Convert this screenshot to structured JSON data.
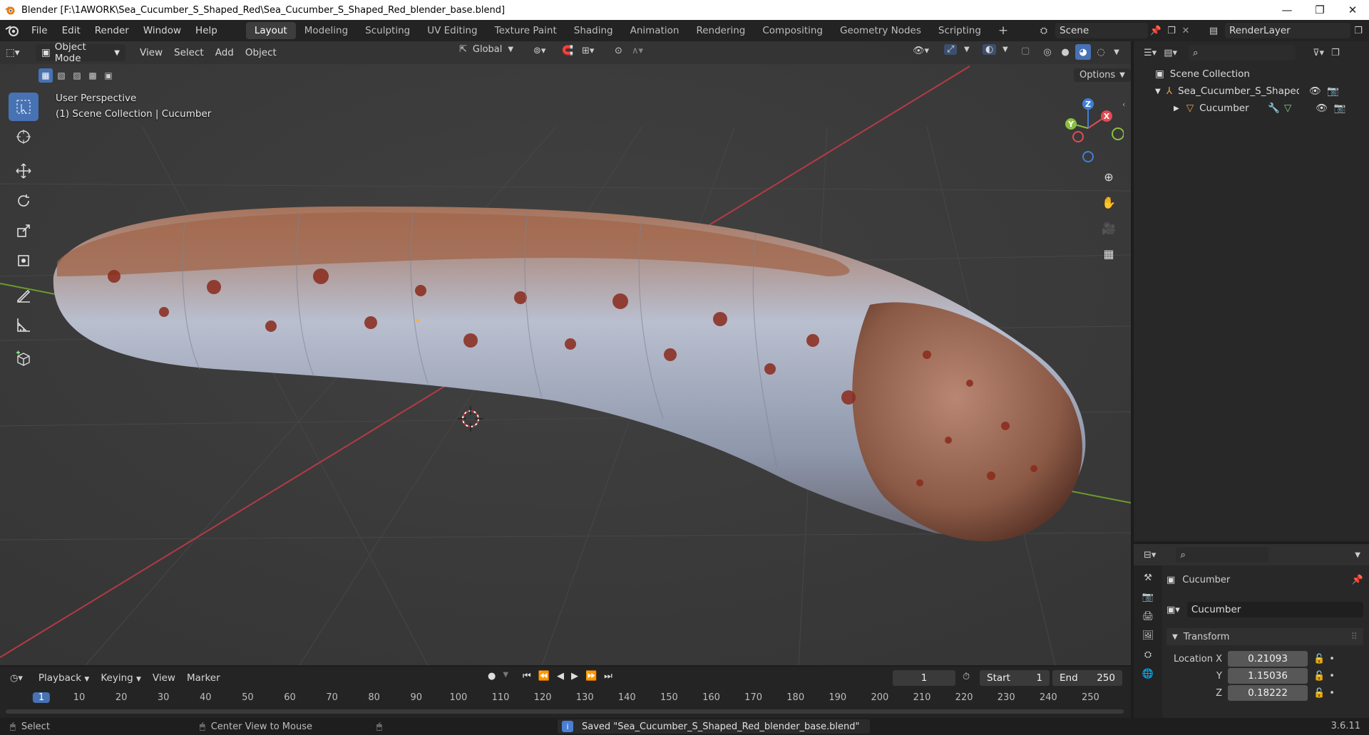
{
  "window": {
    "title": "Blender [F:\\1AWORK\\Sea_Cucumber_S_Shaped_Red\\Sea_Cucumber_S_Shaped_Red_blender_base.blend]",
    "minimize": "—",
    "maximize": "❐",
    "close": "✕"
  },
  "menu": [
    "File",
    "Edit",
    "Render",
    "Window",
    "Help"
  ],
  "workspaces": [
    "Layout",
    "Modeling",
    "Sculpting",
    "UV Editing",
    "Texture Paint",
    "Shading",
    "Animation",
    "Rendering",
    "Compositing",
    "Geometry Nodes",
    "Scripting"
  ],
  "scene": {
    "name": "Scene",
    "render_layer": "RenderLayer"
  },
  "viewport": {
    "mode": "Object Mode",
    "menus": [
      "View",
      "Select",
      "Add",
      "Object"
    ],
    "transform_orientation": "Global",
    "options": "Options",
    "perspective": "User Perspective",
    "collection_info": "(1) Scene Collection | Cucumber",
    "gizmo_axes": {
      "x": "X",
      "y": "Y",
      "z": "Z"
    }
  },
  "outliner": {
    "root": "Scene Collection",
    "items": [
      {
        "label": "Sea_Cucumber_S_Shaped_Re"
      },
      {
        "label": "Cucumber"
      }
    ]
  },
  "properties": {
    "object_name": "Cucumber",
    "data_name": "Cucumber",
    "panel": "Transform",
    "location_label": "Location X",
    "y_label": "Y",
    "z_label": "Z",
    "location": {
      "x": "0.21093",
      "y": "1.15036",
      "z": "0.18222"
    }
  },
  "timeline": {
    "menus": [
      "Playback",
      "Keying",
      "View",
      "Marker"
    ],
    "current_frame": "1",
    "start_label": "Start",
    "start": "1",
    "end_label": "End",
    "end": "250",
    "ticks": [
      "1",
      "10",
      "20",
      "30",
      "40",
      "50",
      "60",
      "70",
      "80",
      "90",
      "100",
      "110",
      "120",
      "130",
      "140",
      "150",
      "160",
      "170",
      "180",
      "190",
      "200",
      "210",
      "220",
      "230",
      "240",
      "250"
    ]
  },
  "status": {
    "select": "Select",
    "center_view": "Center View to Mouse",
    "message": "Saved \"Sea_Cucumber_S_Shaped_Red_blender_base.blend\"",
    "version": "3.6.11"
  },
  "colors": {
    "accent": "#4772b3",
    "axis_x": "#e24a55",
    "axis_y": "#8bbf3f",
    "axis_z": "#3f7fd6"
  }
}
